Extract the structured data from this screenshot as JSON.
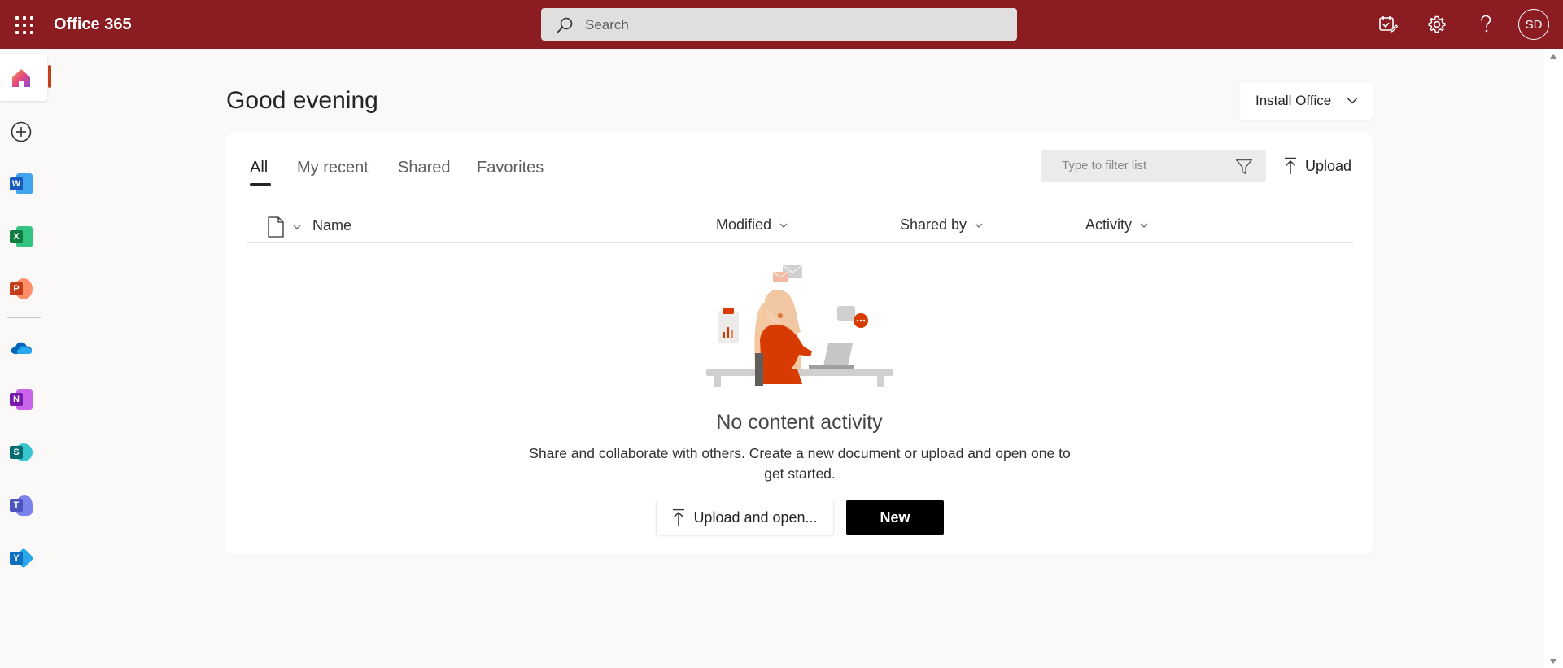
{
  "topbar": {
    "app_title": "Office 365",
    "search_placeholder": "Search",
    "avatar_initials": "SD",
    "icons": [
      "app-launcher-icon",
      "my-day-icon",
      "settings-icon",
      "help-icon"
    ],
    "background_color": "#8b1c21"
  },
  "rail": {
    "items": [
      {
        "name": "Home",
        "icon": "home-icon"
      },
      {
        "name": "Create",
        "icon": "create-icon"
      },
      {
        "name": "Word",
        "icon": "word-icon",
        "letter": "W",
        "color": "#185abd"
      },
      {
        "name": "Excel",
        "icon": "excel-icon",
        "letter": "X",
        "color": "#107c41"
      },
      {
        "name": "PowerPoint",
        "icon": "powerpoint-icon",
        "letter": "P",
        "color": "#c43e1c"
      },
      {
        "name": "OneDrive",
        "icon": "onedrive-icon"
      },
      {
        "name": "OneNote",
        "icon": "onenote-icon",
        "letter": "N",
        "color": "#7719aa"
      },
      {
        "name": "SharePoint",
        "icon": "sharepoint-icon",
        "letter": "S",
        "color": "#036c70"
      },
      {
        "name": "Teams",
        "icon": "teams-icon",
        "letter": "T",
        "color": "#4b53bc"
      },
      {
        "name": "Yammer",
        "icon": "yammer-icon",
        "letter": "Y",
        "color": "#106ebe"
      }
    ],
    "active_indicator_color": "#c43e1c"
  },
  "main": {
    "greeting": "Good evening",
    "install_office_label": "Install Office",
    "tabs": [
      {
        "label": "All",
        "active": true
      },
      {
        "label": "My recent",
        "active": false
      },
      {
        "label": "Shared",
        "active": false
      },
      {
        "label": "Favorites",
        "active": false
      }
    ],
    "filter_placeholder": "Type to filter list",
    "upload_label": "Upload",
    "columns": {
      "name": "Name",
      "modified": "Modified",
      "shared_by": "Shared by",
      "activity": "Activity"
    },
    "empty_state": {
      "title": "No content activity",
      "description": "Share and collaborate with others. Create a new document or upload and open one to get started.",
      "upload_open_label": "Upload and open...",
      "new_label": "New"
    }
  }
}
